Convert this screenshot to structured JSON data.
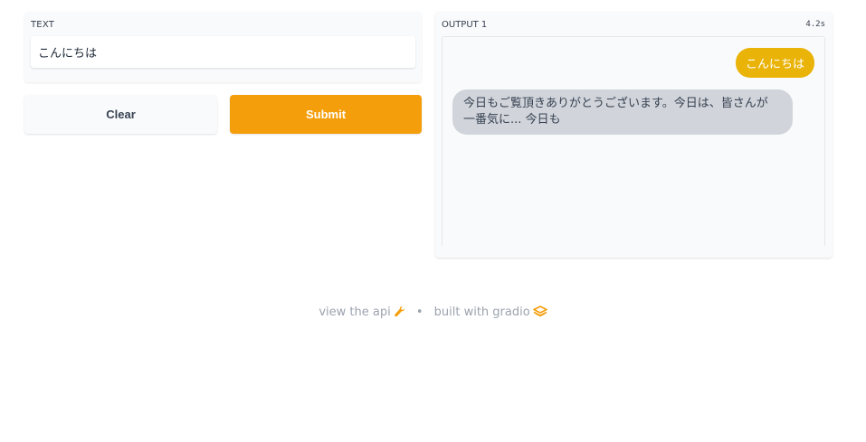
{
  "input": {
    "label": "TEXT",
    "value": "こんにちは"
  },
  "buttons": {
    "clear_label": "Clear",
    "submit_label": "Submit"
  },
  "output": {
    "label": "OUTPUT 1",
    "timer": "4.2s",
    "messages": [
      {
        "role": "user",
        "text": "こんにちは"
      },
      {
        "role": "bot",
        "text": "今日もご覧頂きありがとうございます。今日は、皆さんが 一番気に... 今日も"
      }
    ]
  },
  "footer": {
    "api_link": "view the api",
    "separator": "•",
    "built_with": "built with gradio"
  },
  "colors": {
    "submit": "#f59e0b",
    "user_bubble": "#eab308",
    "bot_bubble": "#d1d5db"
  },
  "icons": {
    "api": "wrench-icon",
    "gradio": "gradio-logo-icon"
  }
}
